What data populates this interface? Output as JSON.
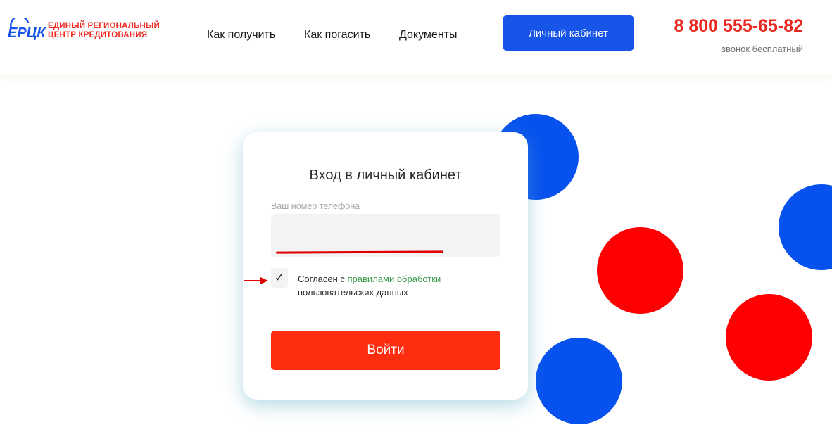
{
  "header": {
    "logo_mark": "ЕРЦК",
    "logo_line1": "ЕДИНЫЙ РЕГИОНАЛЬНЫЙ",
    "logo_line2": "ЦЕНТР КРЕДИТОВАНИЯ",
    "nav": [
      "Как получить",
      "Как погасить",
      "Документы"
    ],
    "cabinet_button": "Личный кабинет",
    "phone": "8 800 555-65-82",
    "phone_note": "звонок бесплатный"
  },
  "login": {
    "title": "Вход в личный кабинет",
    "phone_label": "Ваш номер телефона",
    "phone_value": "",
    "checkbox_mark": "✓",
    "agree_prefix": "Согласен с ",
    "agree_link": "правилами обработки",
    "agree_suffix": "пользовательских данных",
    "submit": "Войти"
  },
  "colors": {
    "brand_blue": "#1754e8",
    "brand_red": "#e8281f",
    "submit_red": "#fe2d10",
    "link_green": "#3a9a4a"
  }
}
